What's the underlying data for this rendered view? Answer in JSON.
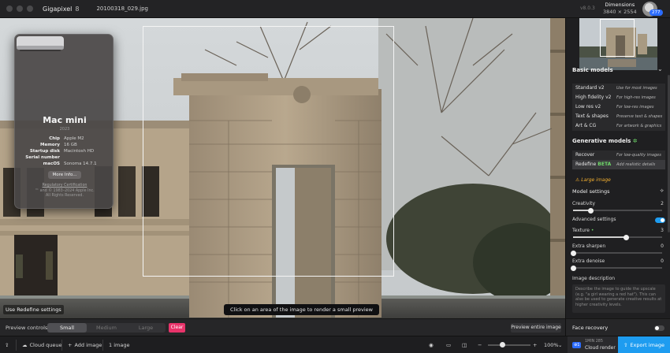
{
  "topbar": {
    "app_name": "Gigapixel",
    "app_version": "8",
    "file_name": "20100318_029.jpg",
    "build_version": "v8.0.3",
    "dimensions_label": "Dimensions",
    "dimensions_value": "3840 × 2554",
    "credits": "277"
  },
  "about_mac": {
    "title": "Mac mini",
    "year": "2023",
    "specs": [
      {
        "key": "Chip",
        "value": "Apple M2"
      },
      {
        "key": "Memory",
        "value": "16 GB"
      },
      {
        "key": "Startup disk",
        "value": "Macintosh HD"
      },
      {
        "key": "Serial number",
        "value": ""
      },
      {
        "key": "macOS",
        "value": "Sonoma 14.7.1"
      }
    ],
    "more_info": "More Info...",
    "regulatory": "Regulatory Certification",
    "copyright_1": "™ and © 1983–2024 Apple Inc.",
    "copyright_2": "All Rights Reserved."
  },
  "canvas": {
    "tooltip": "Click on an area of the image to render a small preview",
    "redefine_tag": "Use Redefine settings"
  },
  "preview_controls": {
    "label": "Preview controls",
    "sizes": [
      "Small",
      "Medium",
      "Large"
    ],
    "selected": "Small",
    "clear": "Clear",
    "preview_entire": "Preview entire image"
  },
  "bottombar": {
    "cloud_queue": "Cloud queue",
    "add_image": "Add image",
    "image_count": "1 image",
    "zoom": "100%",
    "zoom_level": 0.35,
    "cloud_render_line1": "1MIN 285",
    "cloud_render_line2": "Cloud render",
    "cloud_badge": "⊕1",
    "export": "Export image"
  },
  "panel": {
    "basic_models_title": "Basic models",
    "basic_models": [
      {
        "name": "Standard v2",
        "desc": "Use for most images"
      },
      {
        "name": "High fidelity v2",
        "desc": "For high-res images"
      },
      {
        "name": "Low res v2",
        "desc": "For low-res images"
      },
      {
        "name": "Text & shapes",
        "desc": "Preserve text & shapes"
      },
      {
        "name": "Art & CG",
        "desc": "For artwork & graphics"
      }
    ],
    "generative_title": "Generative models",
    "generative_models": [
      {
        "name": "Recover",
        "desc": "For low-quality images"
      },
      {
        "name": "Redefine",
        "badge": "BETA",
        "desc": "Add realistic details"
      }
    ],
    "large_image": "Large image",
    "model_settings": "Model settings",
    "creativity_label": "Creativity",
    "creativity_value": "2",
    "creativity_level": 0.2,
    "advanced_label": "Advanced settings",
    "advanced_on": true,
    "texture_label": "Texture",
    "texture_value": "3",
    "texture_level": 0.6,
    "sharpen_label": "Extra sharpen",
    "sharpen_value": "0",
    "denoise_label": "Extra denoise",
    "denoise_value": "0",
    "image_desc_label": "Image description",
    "image_desc_placeholder": "Describe the image to guide the upscale (e.g. \"a girl wearing a red hat\"). This can also be used to generate creative results at higher creativity levels.",
    "face_recovery": "Face recovery",
    "face_recovery_on": false
  },
  "colors": {
    "accent_blue": "#1e9cf0",
    "clear_pink": "#e8336a",
    "beta_green": "#6fd86a",
    "warning_orange": "#f4b030"
  }
}
